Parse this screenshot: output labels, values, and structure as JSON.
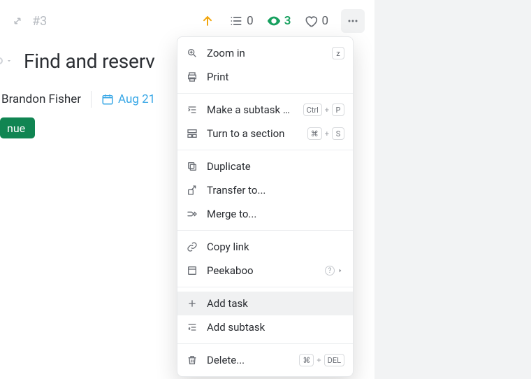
{
  "topbar": {
    "number_label": "#3",
    "list_count": "0",
    "watch_count": "3",
    "like_count": "0"
  },
  "title": "Find and reserv",
  "meta": {
    "assignee": "Brandon Fisher",
    "date": "Aug 21"
  },
  "tag": {
    "label": "nue"
  },
  "menu": {
    "zoom_in": "Zoom in",
    "zoom_key": "z",
    "print": "Print",
    "make_subtask": "Make a subtask of...",
    "ctrl": "Ctrl",
    "p": "P",
    "turn_section": "Turn to a section",
    "cmd": "⌘",
    "s": "S",
    "duplicate": "Duplicate",
    "transfer": "Transfer to...",
    "merge": "Merge to...",
    "copy_link": "Copy link",
    "peekaboo": "Peekaboo",
    "add_task": "Add task",
    "add_subtask": "Add subtask",
    "delete": "Delete...",
    "del": "DEL"
  }
}
